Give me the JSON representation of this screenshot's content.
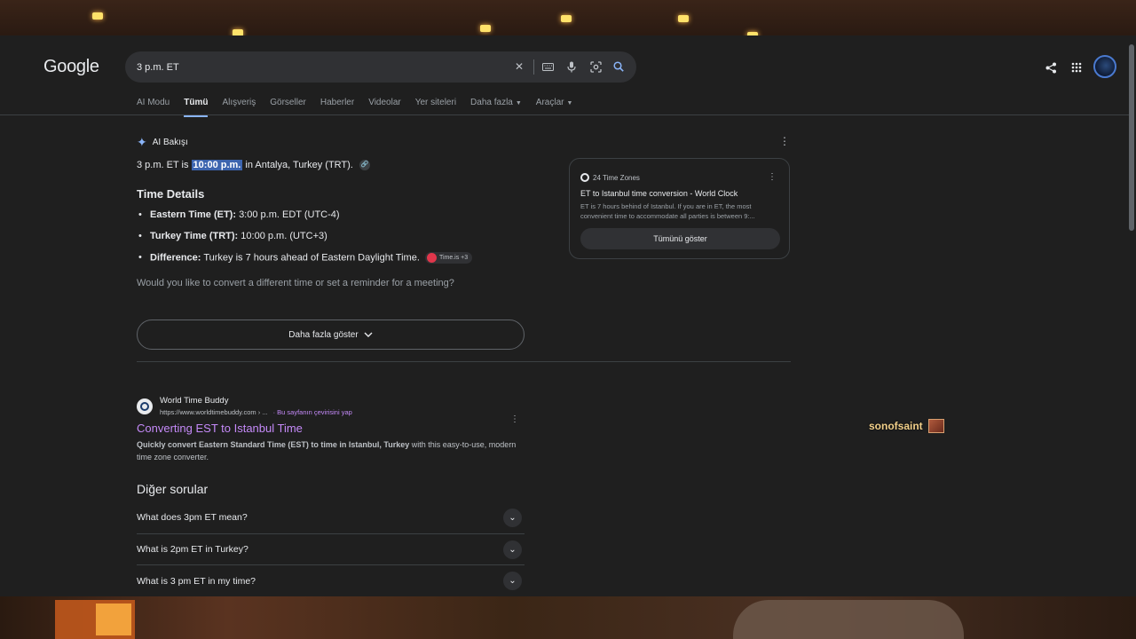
{
  "google": {
    "logo": "Google",
    "search": {
      "value": "3 p.m. ET",
      "placeholder": ""
    }
  },
  "tabs": [
    {
      "label": "AI Modu"
    },
    {
      "label": "Tümü",
      "active": true
    },
    {
      "label": "Alışveriş"
    },
    {
      "label": "Görseller"
    },
    {
      "label": "Haberler"
    },
    {
      "label": "Videolar"
    },
    {
      "label": "Yer siteleri"
    },
    {
      "label": "Daha fazla"
    },
    {
      "label": "Araçlar"
    }
  ],
  "ai": {
    "title": "AI Bakışı",
    "answer_pre": "3 p.m. ET is",
    "answer_hl": "10:00 p.m.",
    "answer_post": "in Antalya, Turkey (TRT).",
    "details_title": "Time Details",
    "bullets": [
      {
        "label": "Eastern Time (ET):",
        "text": "3:00 p.m. EDT (UTC-4)"
      },
      {
        "label": "Turkey Time (TRT):",
        "text": "10:00 p.m. (UTC+3)"
      },
      {
        "label": "Difference:",
        "text": "Turkey is 7 hours ahead of Eastern Daylight Time."
      }
    ],
    "source_chip": "Time.is +3",
    "followup": "Would you like to convert a different time or set a reminder for a meeting?",
    "more_label": "Daha fazla göster"
  },
  "card": {
    "source": "24 Time Zones",
    "title": "ET to Istanbul time conversion - World Clock",
    "snippet": "ET is 7 hours behind of Istanbul. If you are in ET, the most convenient time to accommodate all parties is between 9:...",
    "button": "Tümünü göster"
  },
  "result": {
    "site": "World Time Buddy",
    "url": "https://www.worldtimebuddy.com › ...",
    "translate": "· Bu sayfanın çevirisini yap",
    "title": "Converting EST to Istanbul Time",
    "snippet_bold": "Quickly convert Eastern Standard Time (EST) to time in Istanbul, Turkey",
    "snippet_rest": "with this easy-to-use, modern time zone converter."
  },
  "related": {
    "title": "Diğer sorular",
    "items": [
      {
        "q": "What does 3pm ET mean?"
      },
      {
        "q": "What is 2pm ET in Turkey?"
      },
      {
        "q": "What is 3 pm ET in my time?"
      }
    ]
  },
  "overlay": {
    "name": "sonofsaint"
  },
  "colors": {
    "background": "#1f1f1f",
    "link_visited": "#c58af9",
    "accent": "#8ab4f8"
  }
}
